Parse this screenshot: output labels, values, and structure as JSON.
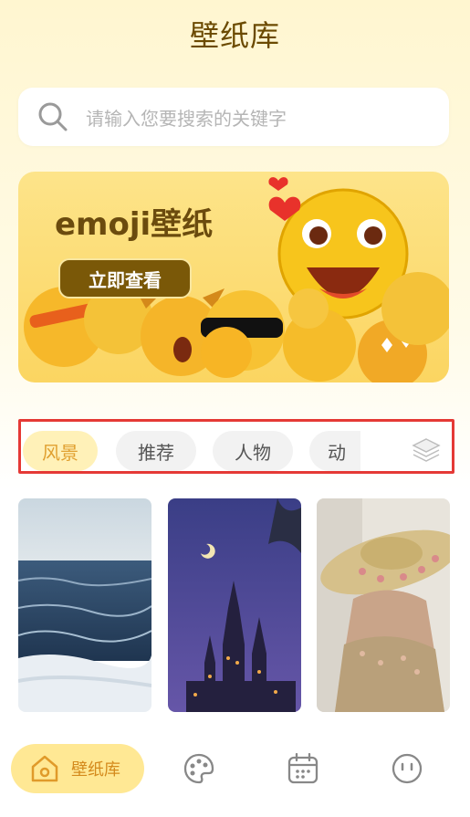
{
  "header": {
    "title": "壁纸库"
  },
  "search": {
    "placeholder": "请输入您要搜索的关键字"
  },
  "banner": {
    "title": "emoji壁纸",
    "button_label": "立即查看"
  },
  "tabs": [
    {
      "label": "风景",
      "active": true
    },
    {
      "label": "推荐",
      "active": false
    },
    {
      "label": "人物",
      "active": false
    },
    {
      "label": "动",
      "active": false
    }
  ],
  "tabs_more_icon": "layers-icon",
  "wallpapers": [
    {
      "subject": "ocean-waves"
    },
    {
      "subject": "castle-night"
    },
    {
      "subject": "woman-flower-hat"
    }
  ],
  "bottom_nav": [
    {
      "label": "壁纸库",
      "icon": "home-icon",
      "active": true
    },
    {
      "icon": "palette-icon"
    },
    {
      "icon": "calendar-icon"
    },
    {
      "icon": "face-icon"
    }
  ],
  "colors": {
    "accent": "#ffe894",
    "accent_text": "#d48a1c",
    "highlight_border": "#e53935"
  }
}
